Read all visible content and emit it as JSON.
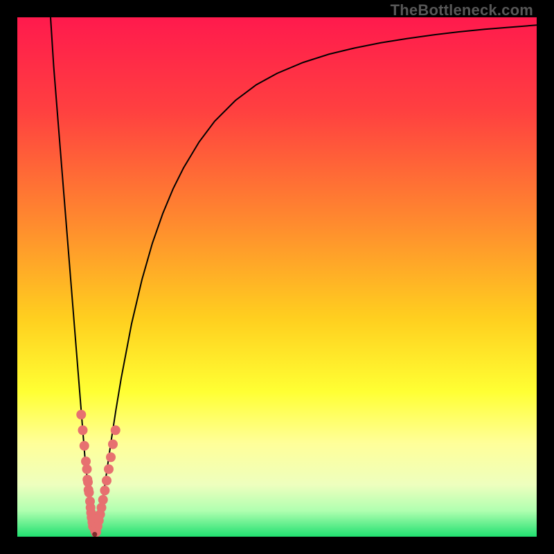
{
  "watermark": "TheBottleneck.com",
  "chart_data": {
    "type": "line",
    "title": "",
    "xlabel": "",
    "ylabel": "",
    "xlim": [
      0,
      100
    ],
    "ylim": [
      0,
      100
    ],
    "background_gradient": {
      "orientation": "vertical",
      "stops": [
        {
          "offset": 0.0,
          "color": "#ff1a4d"
        },
        {
          "offset": 0.18,
          "color": "#ff4040"
        },
        {
          "offset": 0.4,
          "color": "#ff8c2e"
        },
        {
          "offset": 0.58,
          "color": "#ffcf1f"
        },
        {
          "offset": 0.72,
          "color": "#ffff33"
        },
        {
          "offset": 0.82,
          "color": "#ffff99"
        },
        {
          "offset": 0.9,
          "color": "#eeffbe"
        },
        {
          "offset": 0.95,
          "color": "#b0ffb0"
        },
        {
          "offset": 1.0,
          "color": "#20e070"
        }
      ]
    },
    "series": [
      {
        "name": "bottleneck-curve",
        "color": "#000000",
        "stroke_width": 2,
        "x": [
          6.4,
          7,
          8,
          9,
          10,
          11,
          12,
          13,
          14,
          14.7,
          15.3,
          16,
          17,
          18,
          19,
          20,
          22,
          24,
          26,
          28,
          30,
          32,
          35,
          38,
          42,
          46,
          50,
          55,
          60,
          65,
          70,
          75,
          80,
          85,
          90,
          95,
          100
        ],
        "y": [
          100,
          90.6,
          78,
          65.5,
          53,
          40.5,
          28,
          15.5,
          6,
          0.5,
          0.5,
          4,
          11,
          18,
          24.5,
          30.5,
          41,
          49.5,
          56.5,
          62.2,
          67,
          71,
          76,
          80,
          84,
          87,
          89.2,
          91.3,
          92.9,
          94.1,
          95.1,
          95.9,
          96.6,
          97.2,
          97.7,
          98.1,
          98.5
        ]
      }
    ],
    "markers": {
      "name": "data-points",
      "color": "#e77070",
      "x_cluster_left": [
        12.3,
        12.6,
        12.9,
        13.2,
        13.5,
        13.7,
        13.4,
        13.6,
        13.8,
        14.0,
        14.1,
        14.2,
        14.3,
        14.45,
        14.55
      ],
      "y_cluster_left": [
        23.5,
        20.5,
        17.5,
        14.5,
        11.0,
        9.0,
        13.0,
        10.5,
        8.5,
        6.8,
        5.6,
        4.6,
        3.7,
        2.8,
        2.0
      ],
      "x_cluster_right": [
        15.2,
        15.45,
        15.7,
        15.95,
        16.2,
        16.5,
        16.85,
        17.2,
        17.6,
        18.0,
        18.4,
        18.9
      ],
      "y_cluster_right": [
        0.9,
        2.0,
        3.1,
        4.3,
        5.6,
        7.1,
        8.9,
        10.8,
        13.0,
        15.3,
        17.8,
        20.5
      ],
      "x_bottom": [
        14.6,
        14.75,
        14.95,
        15.05,
        14.85,
        15.15,
        14.65,
        15.0
      ],
      "y_bottom": [
        1.4,
        0.9,
        0.6,
        0.7,
        0.55,
        1.0,
        1.0,
        0.5
      ],
      "radius_small": 4.5,
      "radius_big": 7
    }
  }
}
